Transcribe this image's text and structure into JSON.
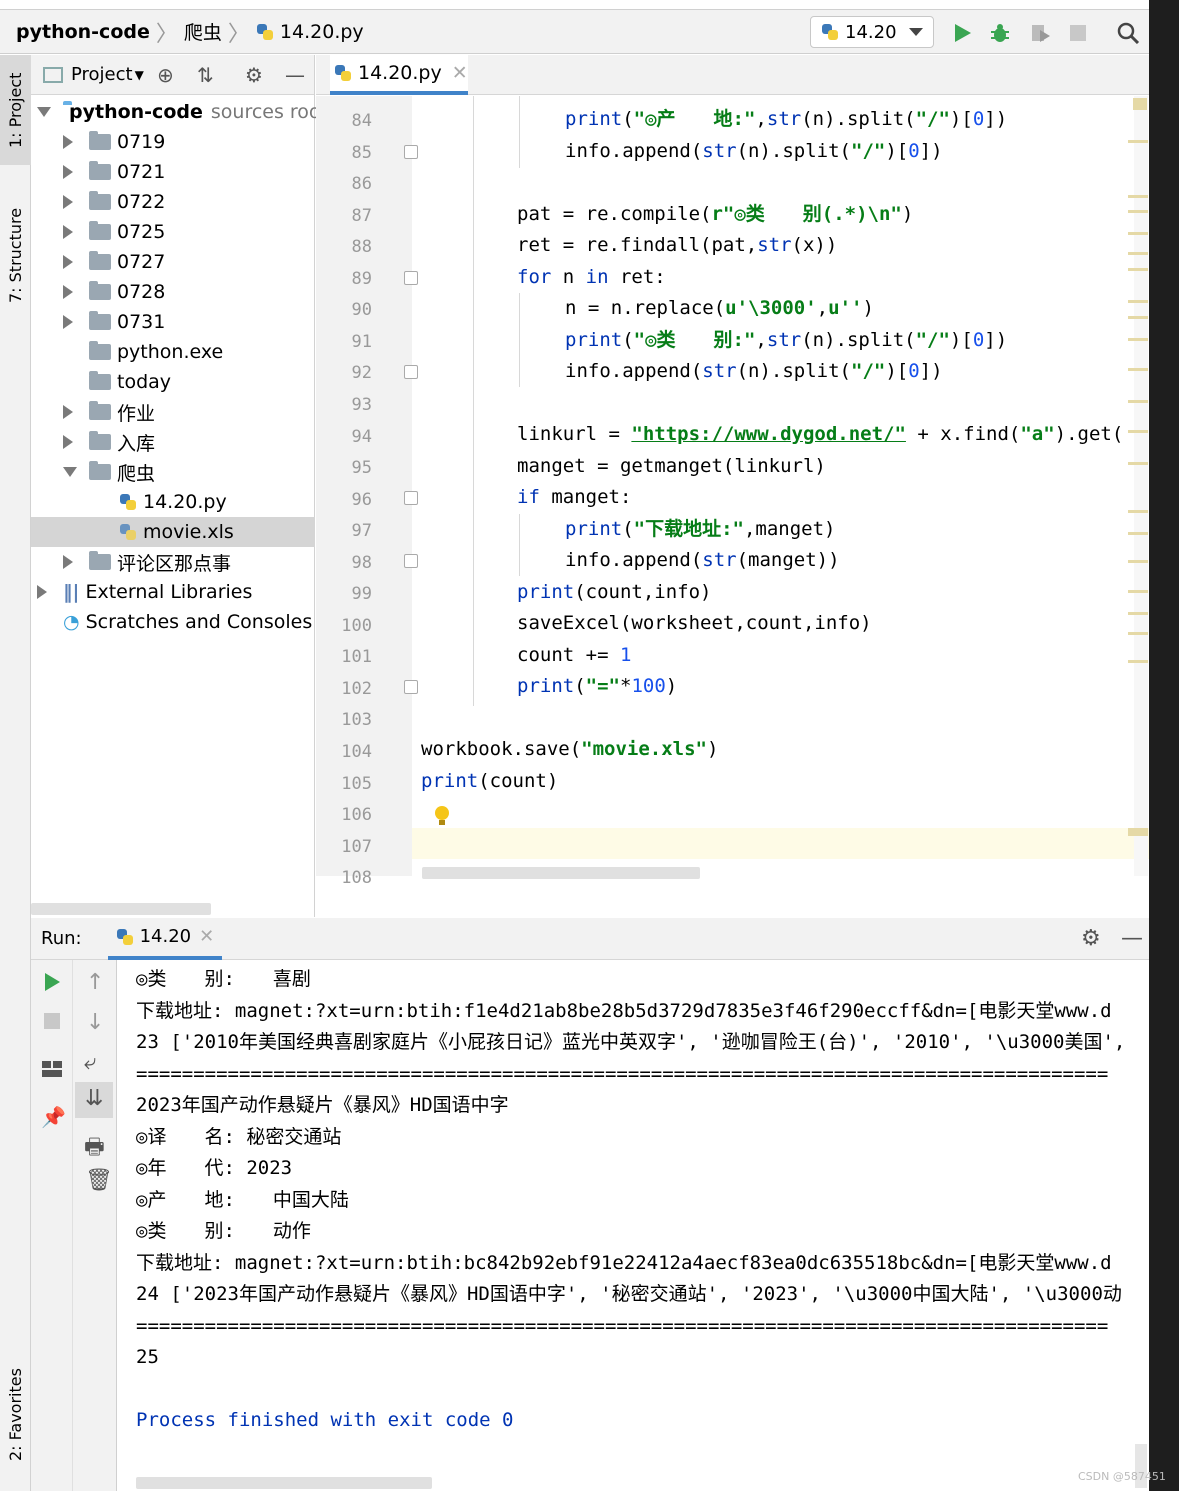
{
  "breadcrumb": {
    "project": "python-code",
    "folder": "爬虫",
    "file": "14.20.py"
  },
  "run_config": "14.20",
  "side_tabs": {
    "project": "1: Project",
    "structure": "7: Structure",
    "favorites": "2: Favorites"
  },
  "project_panel": {
    "title": "Project",
    "root_name": "python-code",
    "root_suffix": "sources roo",
    "items": [
      {
        "label": "0719"
      },
      {
        "label": "0721"
      },
      {
        "label": "0722"
      },
      {
        "label": "0725"
      },
      {
        "label": "0727"
      },
      {
        "label": "0728"
      },
      {
        "label": "0731"
      },
      {
        "label": "python.exe"
      },
      {
        "label": "today"
      },
      {
        "label": "作业"
      },
      {
        "label": "入库"
      },
      {
        "label": "爬虫"
      },
      {
        "label": "14.20.py"
      },
      {
        "label": "movie.xls"
      },
      {
        "label": "评论区那点事"
      },
      {
        "label": "External Libraries"
      },
      {
        "label": "Scratches and Consoles"
      }
    ]
  },
  "editor": {
    "tab": "14.20.py",
    "line_numbers": [
      "84",
      "85",
      "86",
      "87",
      "88",
      "89",
      "90",
      "91",
      "92",
      "93",
      "94",
      "95",
      "96",
      "97",
      "98",
      "99",
      "100",
      "101",
      "102",
      "103",
      "104",
      "105",
      "106",
      "107",
      "108"
    ]
  },
  "run": {
    "label": "Run:",
    "tab": "14.20",
    "output": [
      "◎类　　别:　　喜剧",
      "下载地址: magnet:?xt=urn:btih:f1e4d21ab8be28b5d3729d7835e3f46f290eccff&dn=[电影天堂www.d",
      "23 ['2010年美国经典喜剧家庭片《小屁孩日记》蓝光中英双字', '逊咖冒险王(台)', '2010', '\\u3000美国',",
      "=====================================================================================",
      "2023年国产动作悬疑片《暴风》HD国语中字",
      "◎译　　名: 秘密交通站",
      "◎年　　代: 2023",
      "◎产　　地:　　中国大陆",
      "◎类　　别:　　动作",
      "下载地址: magnet:?xt=urn:btih:bc842b92ebf91e22412a4aecf83ea0dc635518bc&dn=[电影天堂www.d",
      "24 ['2023年国产动作悬疑片《暴风》HD国语中字', '秘密交通站', '2023', '\\u3000中国大陆', '\\u3000动",
      "=====================================================================================",
      "25",
      "",
      "Process finished with exit code 0"
    ]
  },
  "watermark": "CSDN @587451"
}
